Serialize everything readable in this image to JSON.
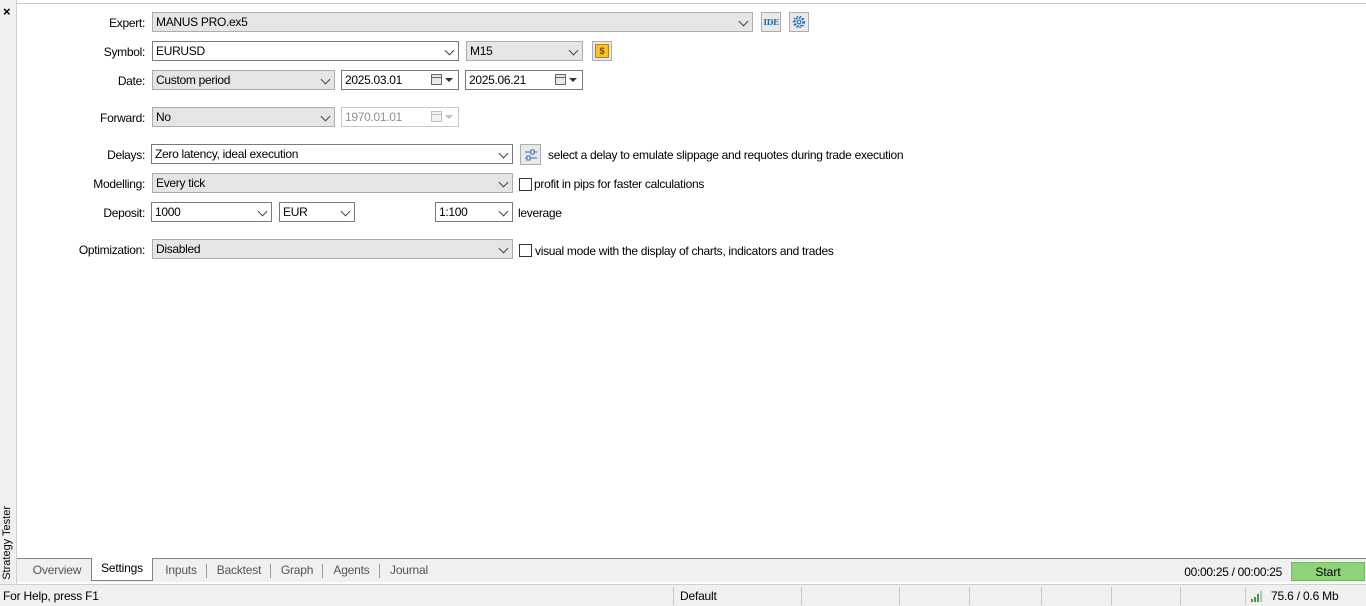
{
  "panel": {
    "close_glyph": "×",
    "vertical_title": "Strategy Tester"
  },
  "form": {
    "expert": {
      "label": "Expert:",
      "value": "MANUS PRO.ex5",
      "ide_button": "IDE",
      "settings_icon": "gear-icon"
    },
    "symbol": {
      "label": "Symbol:",
      "value": "EURUSD",
      "timeframe": "M15",
      "symbol_icon": "dollar-icon"
    },
    "date": {
      "label": "Date:",
      "period": "Custom period",
      "from": "2025.03.01",
      "to": "2025.06.21"
    },
    "forward": {
      "label": "Forward:",
      "value": "No",
      "date": "1970.01.01"
    },
    "delays": {
      "label": "Delays:",
      "value": "Zero latency, ideal execution",
      "note": "select a delay to emulate slippage and requotes during trade execution",
      "icon": "sliders-icon"
    },
    "modelling": {
      "label": "Modelling:",
      "value": "Every tick",
      "checkbox_label": "profit in pips for faster calculations",
      "checked": false
    },
    "deposit": {
      "label": "Deposit:",
      "amount": "1000",
      "currency": "EUR",
      "leverage": "1:100",
      "leverage_label": "leverage"
    },
    "optimization": {
      "label": "Optimization:",
      "value": "Disabled",
      "checkbox_label": "visual mode with the display of charts, indicators and trades",
      "checked": false
    }
  },
  "tabs": [
    {
      "label": "Overview"
    },
    {
      "label": "Settings"
    },
    {
      "label": "Inputs"
    },
    {
      "label": "Backtest"
    },
    {
      "label": "Graph"
    },
    {
      "label": "Agents"
    },
    {
      "label": "Journal"
    }
  ],
  "active_tab": "Settings",
  "timer": "00:00:25 / 00:00:25",
  "start_label": "Start",
  "status": {
    "help": "For Help, press F1",
    "profile": "Default",
    "traffic": "75.6 / 0.6 Mb"
  },
  "colors": {
    "start_button": "#8fd27a",
    "dollar_icon": "#f6c12b",
    "signal_bars": "#3aa335"
  }
}
